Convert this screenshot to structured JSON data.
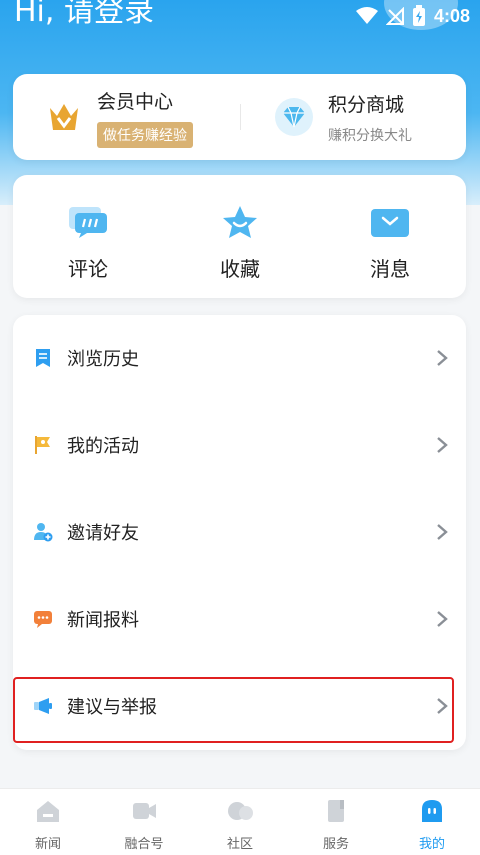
{
  "status_bar": {
    "time": "4:08"
  },
  "header": {
    "greeting": "Hi, 请登录"
  },
  "member": {
    "title": "会员中心",
    "badge": "做任务赚经验",
    "mall_title": "积分商城",
    "mall_sub": "赚积分换大礼"
  },
  "quick": [
    {
      "label": "评论",
      "icon": "comment-icon"
    },
    {
      "label": "收藏",
      "icon": "star-icon"
    },
    {
      "label": "消息",
      "icon": "message-icon"
    }
  ],
  "menu": [
    {
      "label": "浏览历史",
      "icon": "history-icon"
    },
    {
      "label": "我的活动",
      "icon": "flag-icon"
    },
    {
      "label": "邀请好友",
      "icon": "invite-user-icon"
    },
    {
      "label": "新闻报料",
      "icon": "news-report-icon"
    },
    {
      "label": "建议与举报",
      "icon": "feedback-icon"
    }
  ],
  "tabs": [
    {
      "label": "新闻",
      "icon": "home-icon"
    },
    {
      "label": "融合号",
      "icon": "video-icon"
    },
    {
      "label": "社区",
      "icon": "community-icon"
    },
    {
      "label": "服务",
      "icon": "book-icon"
    },
    {
      "label": "我的",
      "icon": "profile-icon",
      "active": true
    }
  ],
  "colors": {
    "accent": "#1f9bf0",
    "gold": "#d9b273",
    "highlight": "#e02020"
  }
}
